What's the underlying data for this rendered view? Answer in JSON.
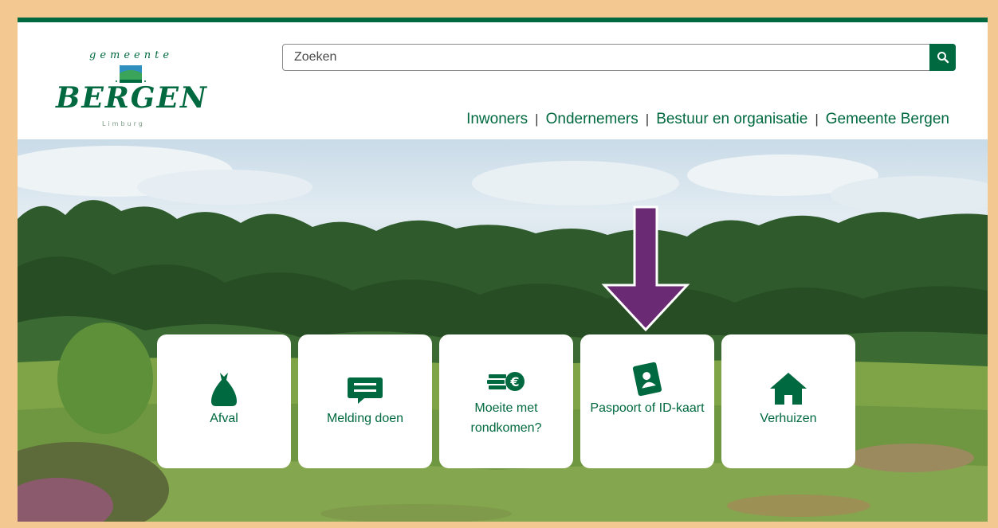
{
  "logo": {
    "top_text": "gemeente",
    "main_text": "BERGEN",
    "sub_text": "Limburg"
  },
  "search": {
    "placeholder": "Zoeken",
    "button_icon": "search-icon"
  },
  "nav": {
    "items": [
      "Inwoners",
      "Ondernemers",
      "Bestuur en organisatie",
      "Gemeente Bergen"
    ],
    "separator": "|"
  },
  "tiles": [
    {
      "label": "Afval",
      "icon": "garbage-bag-icon"
    },
    {
      "label": "Melding doen",
      "icon": "chat-bubble-icon"
    },
    {
      "label": "Moeite met rondkomen?",
      "icon": "money-coins-icon"
    },
    {
      "label": "Paspoort of ID-kaart",
      "icon": "passport-icon"
    },
    {
      "label": "Verhuizen",
      "icon": "house-icon"
    }
  ],
  "annotation": {
    "icon": "arrow-down-icon",
    "color": "#6b2a74"
  },
  "colors": {
    "brand": "#00693f",
    "frame": "#f3c891"
  }
}
